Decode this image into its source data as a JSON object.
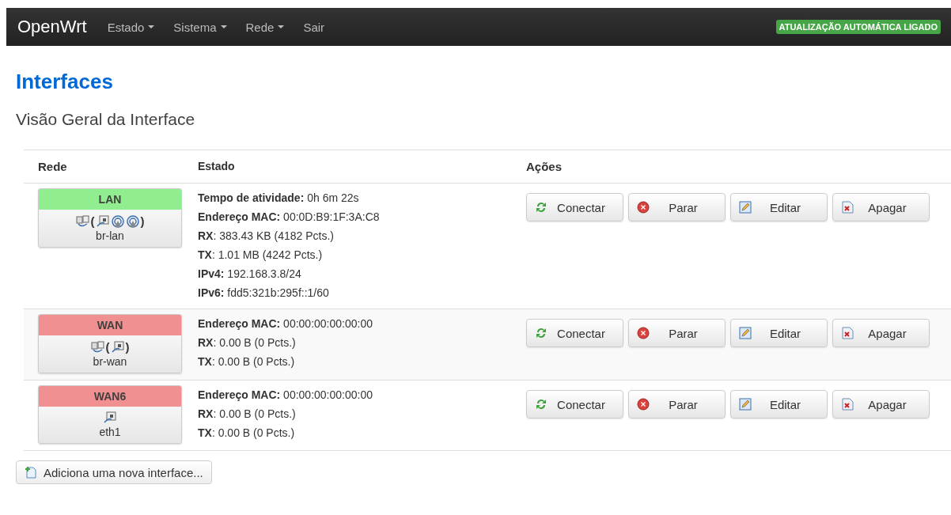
{
  "navbar": {
    "brand": "OpenWrt",
    "menus": [
      {
        "label": "Estado",
        "dropdown": true
      },
      {
        "label": "Sistema",
        "dropdown": true
      },
      {
        "label": "Rede",
        "dropdown": true
      },
      {
        "label": "Sair",
        "dropdown": false
      }
    ],
    "badge": "ATUALIZAÇÃO AUTOMÁTICA LIGADO"
  },
  "title": "Interfaces",
  "section_title": "Visão Geral da Interface",
  "table": {
    "columns": [
      "Rede",
      "Estado",
      "Ações"
    ],
    "rows": [
      {
        "name": "LAN",
        "color": "#90ee90",
        "devices": [
          {
            "kind": "bridge"
          },
          {
            "kind": "text",
            "text": "("
          },
          {
            "kind": "ethernet"
          },
          {
            "kind": "wifi"
          },
          {
            "kind": "wifi"
          },
          {
            "kind": "text",
            "text": ")"
          }
        ],
        "ifname": "br-lan",
        "stats": [
          "**Tempo de atividade:** 0h 6m 22s",
          "**Endereço MAC:** 00:0D:B9:1F:3A:C8",
          "**RX**: 383.43 KB (4182 Pcts.)",
          "**TX**: 1.01 MB (4242 Pcts.)",
          "**IPv4:** 192.168.3.8/24",
          "**IPv6:** fdd5:321b:295f::1/60"
        ],
        "actions": [
          {
            "kind": "connect",
            "label": "Conectar"
          },
          {
            "kind": "stop",
            "label": "Parar"
          },
          {
            "kind": "edit",
            "label": "Editar"
          },
          {
            "kind": "delete",
            "label": "Apagar"
          }
        ]
      },
      {
        "name": "WAN",
        "color": "#f09090",
        "devices": [
          {
            "kind": "bridge"
          },
          {
            "kind": "text",
            "text": "("
          },
          {
            "kind": "ethernet"
          },
          {
            "kind": "text",
            "text": ")"
          }
        ],
        "ifname": "br-wan",
        "stats": [
          "**Endereço MAC:** 00:00:00:00:00:00",
          "**RX**: 0.00 B (0 Pcts.)",
          "**TX**: 0.00 B (0 Pcts.)"
        ],
        "actions": [
          {
            "kind": "connect",
            "label": "Conectar"
          },
          {
            "kind": "stop",
            "label": "Parar"
          },
          {
            "kind": "edit",
            "label": "Editar"
          },
          {
            "kind": "delete",
            "label": "Apagar"
          }
        ]
      },
      {
        "name": "WAN6",
        "color": "#f09090",
        "devices": [
          {
            "kind": "ethernet"
          }
        ],
        "ifname": "eth1",
        "stats": [
          "**Endereço MAC:** 00:00:00:00:00:00",
          "**RX**: 0.00 B (0 Pcts.)",
          "**TX**: 0.00 B (0 Pcts.)"
        ],
        "actions": [
          {
            "kind": "connect",
            "label": "Conectar"
          },
          {
            "kind": "stop",
            "label": "Parar"
          },
          {
            "kind": "edit",
            "label": "Editar"
          },
          {
            "kind": "delete",
            "label": "Apagar"
          }
        ]
      }
    ]
  },
  "add_button": "Adiciona uma nova interface..."
}
